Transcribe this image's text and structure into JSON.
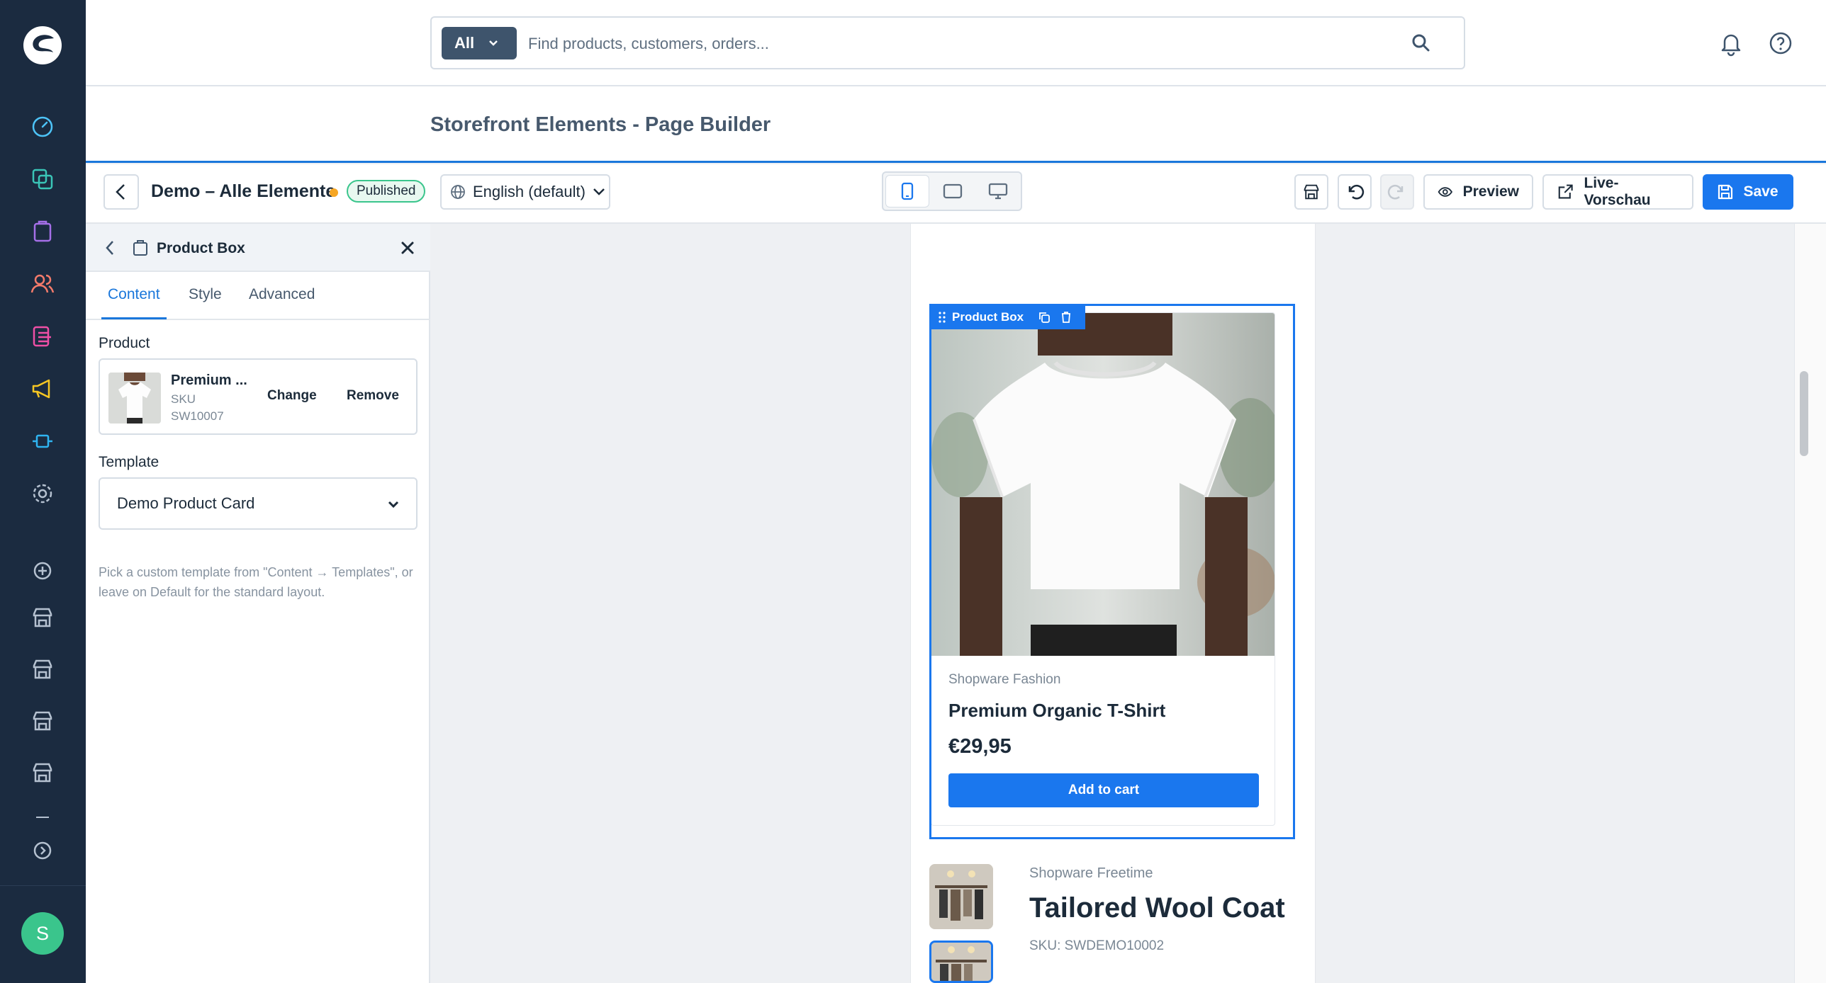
{
  "rail": {
    "avatar_initial": "S",
    "items": [
      {
        "icon": "dashboard-icon",
        "color": "#4dc3f7"
      },
      {
        "icon": "catalogue-icon",
        "color": "#3ac5b7"
      },
      {
        "icon": "orders-icon",
        "color": "#a56fe8"
      },
      {
        "icon": "customers-icon",
        "color": "#f47b6b"
      },
      {
        "icon": "content-icon",
        "color": "#ee4fa5"
      },
      {
        "icon": "marketing-icon",
        "color": "#f6c623"
      },
      {
        "icon": "extensions-icon",
        "color": "#2fb4f1"
      },
      {
        "icon": "settings-icon",
        "color": "#b5c1d0"
      },
      {
        "icon": "add-sales-channel-icon",
        "color": "#b5c1d0"
      },
      {
        "icon": "storefront-icon",
        "color": "#b5c1d0"
      },
      {
        "icon": "storefront-icon",
        "color": "#b5c1d0"
      },
      {
        "icon": "storefront-icon",
        "color": "#b5c1d0"
      },
      {
        "icon": "storefront-icon",
        "color": "#b5c1d0"
      },
      {
        "icon": "expand-menu-icon",
        "color": "#b5c1d0"
      }
    ]
  },
  "search": {
    "scope": "All",
    "placeholder": "Find products, customers, orders..."
  },
  "header": {
    "page_title": "Storefront Elements - Page Builder"
  },
  "toolbar": {
    "document_name": "Demo – Alle Elemente",
    "status": "Published",
    "language": "English (default)",
    "preview_label": "Preview",
    "live_preview_label": "Live-Vorschau",
    "save_label": "Save",
    "active_device": "mobile"
  },
  "panel": {
    "title": "Product Box",
    "tabs": [
      "Content",
      "Style",
      "Advanced"
    ],
    "active_tab": "Content",
    "product_label": "Product",
    "product": {
      "name": "Premium ...",
      "sku_label": "SKU",
      "sku": "SW10007",
      "change_label": "Change",
      "remove_label": "Remove"
    },
    "template_label": "Template",
    "template_value": "Demo Product Card",
    "template_hint": "Pick a custom template from \"Content → Templates\", or leave on Default for the standard layout."
  },
  "canvas": {
    "selection_label": "Product Box",
    "product_box": {
      "manufacturer": "Shopware Fashion",
      "name": "Premium Organic T-Shirt",
      "price": "€29,95",
      "cart_label": "Add to cart"
    },
    "next_product": {
      "manufacturer": "Shopware Freetime",
      "name": "Tailored Wool Coat",
      "sku": "SKU: SWDEMO10002"
    }
  },
  "colors": {
    "accent": "#1a77ee",
    "rail_bg": "#1b2b40",
    "published": "#3ac58c",
    "unsaved_dot": "#f6a623"
  }
}
